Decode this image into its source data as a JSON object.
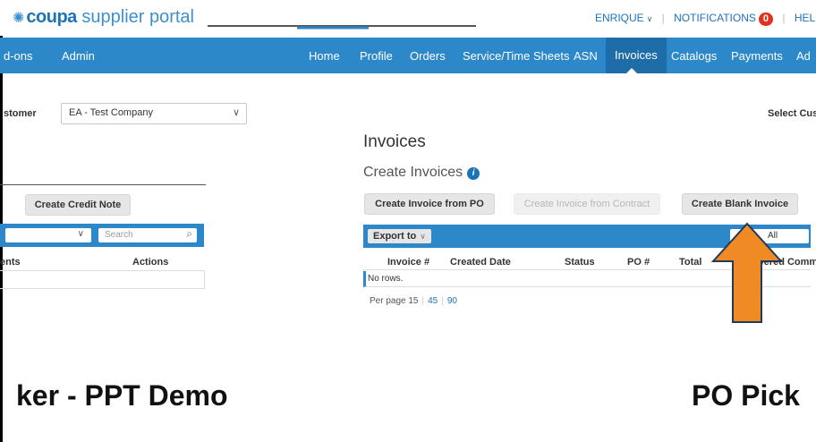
{
  "header": {
    "brand": "coupa",
    "portal": "supplier portal",
    "user_label": "ENRIQUE",
    "notifications_label": "NOTIFICATIONS",
    "notifications_count": "0",
    "help_label": "HELP"
  },
  "nav_left": [
    "d-ons",
    "Admin"
  ],
  "nav_right": [
    "Home",
    "Profile",
    "Orders",
    "Service/Time Sheets",
    "ASN",
    "Invoices",
    "Catalogs",
    "Payments",
    "Ad"
  ],
  "nav_active": "Invoices",
  "left_panel": {
    "customer_label": "stomer",
    "customer_value": "EA - Test Company",
    "create_credit_note_label": "Create Credit Note",
    "search_placeholder": "Search",
    "col_contents": "ents",
    "col_actions": "Actions"
  },
  "right_panel": {
    "select_customer_label": "Select Cus",
    "page_title": "Invoices",
    "section_title": "Create Invoices",
    "btn_from_po": "Create Invoice from PO",
    "btn_from_contract": "Create Invoice from Contract",
    "btn_blank": "Create Blank Invoice",
    "export_label": "Export to",
    "filter_value": "All",
    "columns": [
      "Invoice #",
      "Created Date",
      "Status",
      "PO #",
      "Total",
      "swered Comm"
    ],
    "no_rows": "No rows.",
    "per_page_label": "Per page",
    "per_page_options": [
      "15",
      "45",
      "90"
    ]
  },
  "slide": {
    "left_text": "ker - PPT Demo",
    "right_text": "PO Pick"
  },
  "colors": {
    "nav_bg": "#2d88c9",
    "nav_active": "#1f6da8",
    "arrow": "#f08a24",
    "badge": "#e0321f"
  }
}
